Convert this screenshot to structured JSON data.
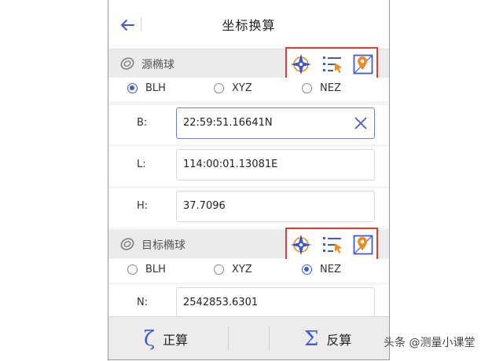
{
  "header": {
    "title": "坐标换算"
  },
  "source": {
    "title": "源椭球",
    "radios": [
      {
        "label": "BLH",
        "selected": true
      },
      {
        "label": "XYZ",
        "selected": false
      },
      {
        "label": "NEZ",
        "selected": false
      }
    ],
    "fields": [
      {
        "label": "B:",
        "value": "22:59:51.16641N"
      },
      {
        "label": "L:",
        "value": "114:00:01.13081E"
      },
      {
        "label": "H:",
        "value": "37.7096"
      }
    ]
  },
  "target": {
    "title": "目标椭球",
    "radios": [
      {
        "label": "BLH",
        "selected": false
      },
      {
        "label": "XYZ",
        "selected": false
      },
      {
        "label": "NEZ",
        "selected": true
      }
    ],
    "fields": [
      {
        "label": "N:",
        "value": "2542853.6301"
      }
    ]
  },
  "icons": {
    "back": "arrow-left-icon",
    "ellipsoid": "ellipsoid-icon",
    "tool1": "compass-star-icon",
    "tool2": "list-cursor-icon",
    "tool3": "map-pin-icon",
    "clear": "close-icon"
  },
  "bottom": {
    "forward_label": "正算",
    "forward_symbol": "ζ",
    "inverse_label": "反算",
    "inverse_symbol": "Σ"
  },
  "watermark": "头条 @测量小课堂",
  "colors": {
    "accent": "#3f5bd4",
    "highlight": "#e53935",
    "orange": "#f08a24"
  }
}
